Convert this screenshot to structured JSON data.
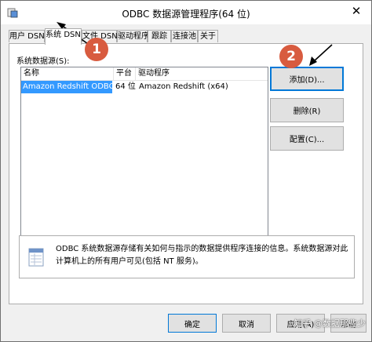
{
  "window": {
    "title": "ODBC 数据源管理程序(64 位)",
    "close_glyph": "✕"
  },
  "tabs": [
    {
      "label": "用户 DSN"
    },
    {
      "label": "系统 DSN"
    },
    {
      "label": "文件 DSN"
    },
    {
      "label": "驱动程序"
    },
    {
      "label": "跟踪"
    },
    {
      "label": "连接池"
    },
    {
      "label": "关于"
    }
  ],
  "active_tab": "系统 DSN",
  "panel": {
    "section_label": "系统数据源(S):"
  },
  "list": {
    "columns": [
      "名称",
      "平台",
      "驱动程序"
    ],
    "rows": [
      {
        "name": "Amazon Redshift ODBC DSN",
        "platform": "64 位",
        "driver": "Amazon Redshift (x64)"
      }
    ]
  },
  "buttons": {
    "add": "添加(D)...",
    "remove": "删除(R)",
    "configure": "配置(C)..."
  },
  "info": {
    "text": "ODBC 系统数据源存储有关如何与指示的数据提供程序连接的信息。系统数据源对此计算机上的所有用户可见(包括 NT 服务)。"
  },
  "footer": {
    "ok": "确定",
    "cancel": "取消",
    "apply": "应用(A)",
    "help": "帮助"
  },
  "annotations": {
    "badge1": "1",
    "badge2": "2"
  },
  "watermark": "知乎 @数据那些少",
  "colors": {
    "selection": "#3399ff",
    "badge": "#d85b3f",
    "accent": "#0078d7"
  }
}
